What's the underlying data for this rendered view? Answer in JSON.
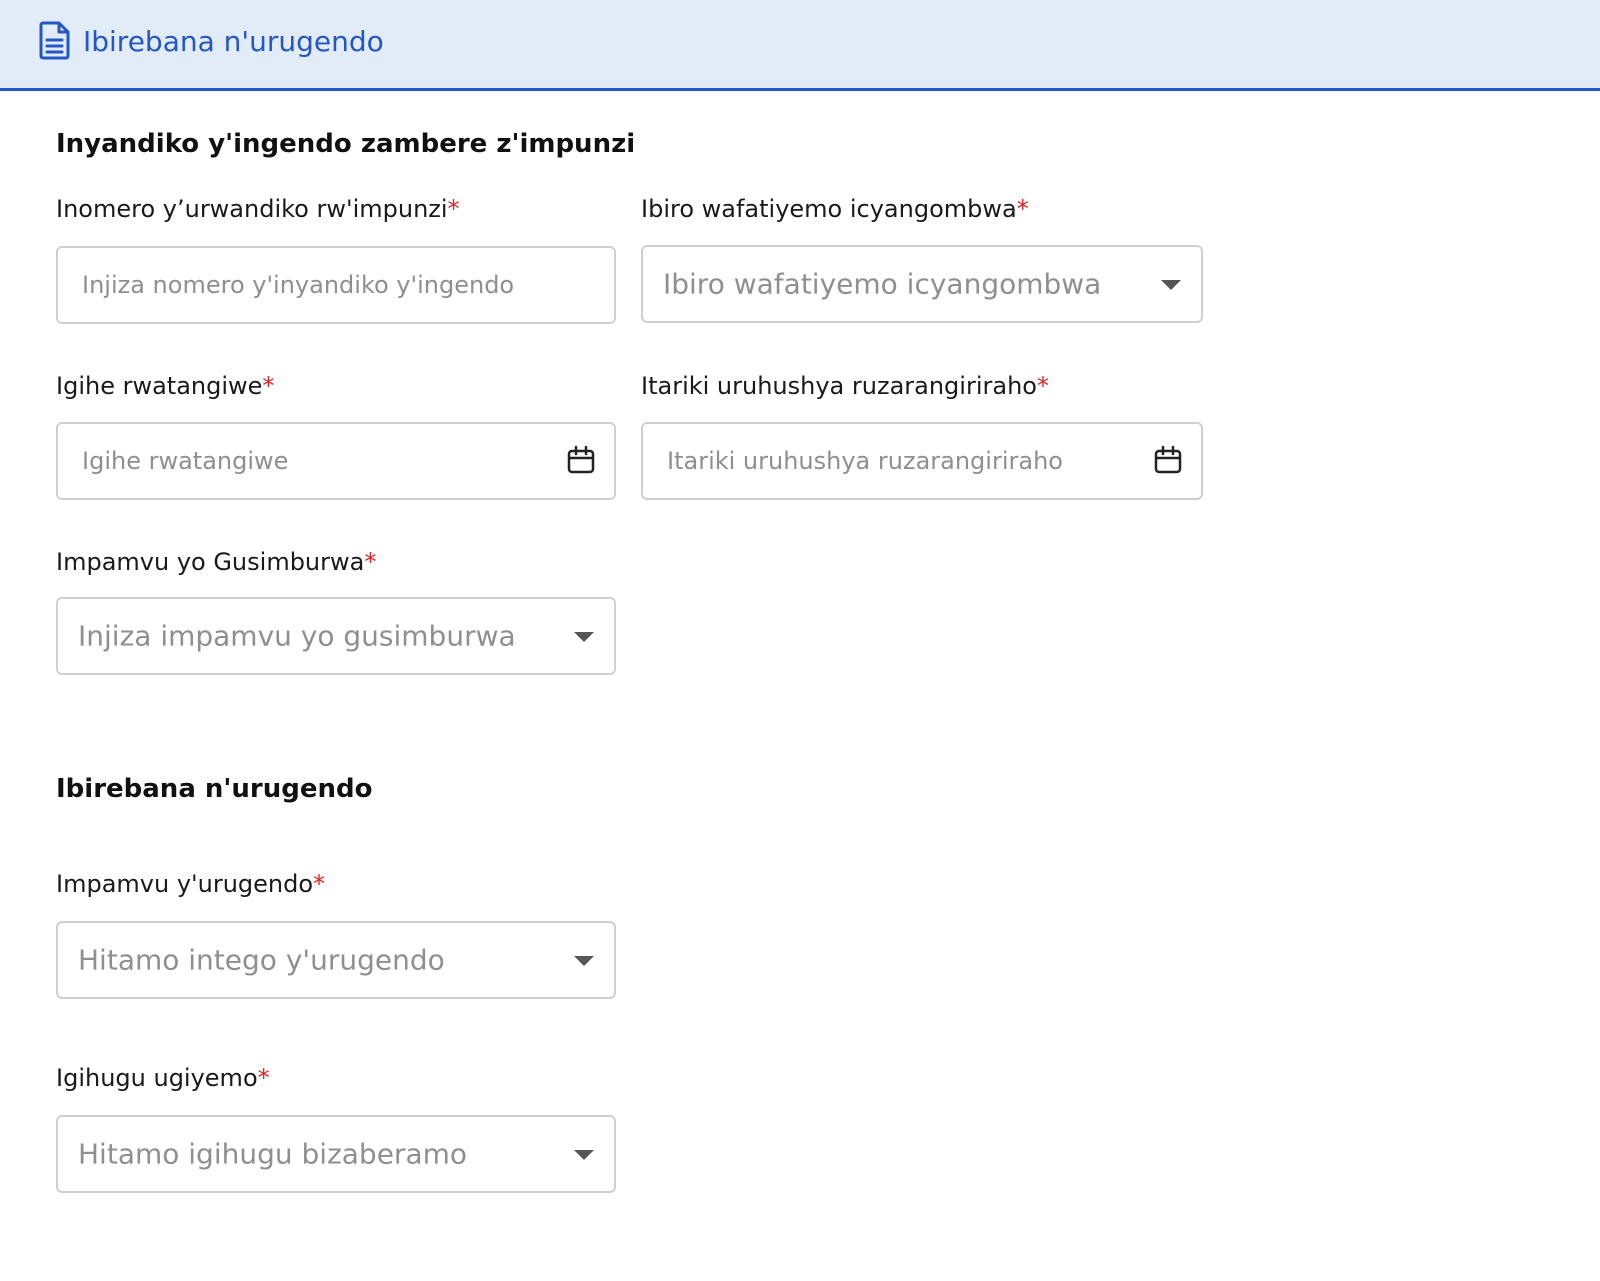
{
  "header": {
    "title": "Ibirebana n'urugendo",
    "icon": "document-icon",
    "color": "#2457c5",
    "background": "#e1ecf8"
  },
  "section1": {
    "title": "Inyandiko y'ingendo zambere z'impunzi",
    "fields": {
      "refugee_number": {
        "label": "Inomero y’urwandiko rw'impunzi",
        "placeholder": "Injiza nomero y'inyandiko y'ingendo"
      },
      "office": {
        "label": "Ibiro wafatiyemo icyangombwa",
        "placeholder": "Ibiro wafatiyemo icyangombwa"
      },
      "issue_date": {
        "label": "Igihe rwatangiwe",
        "placeholder": "Igihe rwatangiwe"
      },
      "expiry_date": {
        "label": "Itariki uruhushya ruzarangiriraho",
        "placeholder": "Itariki uruhushya ruzarangiriraho"
      },
      "renewal_reason": {
        "label": "Impamvu yo Gusimburwa",
        "placeholder": "Injiza impamvu yo gusimburwa"
      }
    }
  },
  "section2": {
    "title": "Ibirebana n'urugendo",
    "fields": {
      "travel_reason": {
        "label": "Impamvu y'urugendo",
        "placeholder": "Hitamo intego y'urugendo"
      },
      "destination_country": {
        "label": "Igihugu ugiyemo",
        "placeholder": "Hitamo igihugu bizaberamo"
      }
    }
  },
  "required_marker": "*",
  "colors": {
    "required": "#e02424",
    "placeholder": "#8f8f8f",
    "border": "#cfcfcf"
  }
}
